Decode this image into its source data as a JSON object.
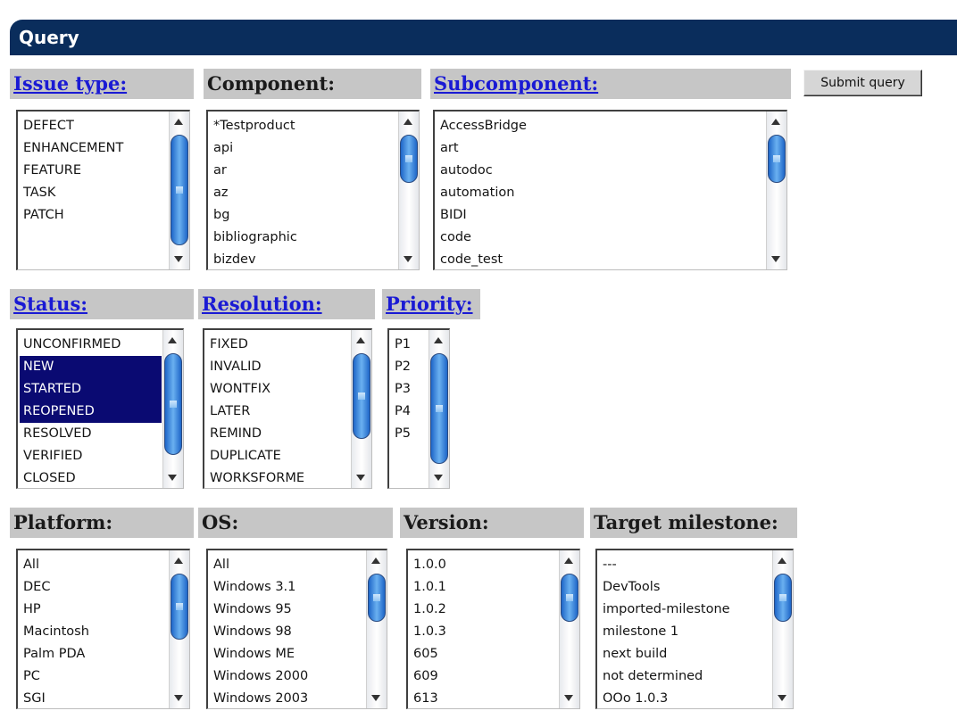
{
  "title": "Query",
  "submit_label": "Submit query",
  "fields": {
    "issue_type": {
      "label": "Issue type:",
      "options": [
        "DEFECT",
        "ENHANCEMENT",
        "FEATURE",
        "TASK",
        "PATCH"
      ]
    },
    "component": {
      "label": "Component:",
      "options": [
        "*Testproduct",
        "api",
        "ar",
        "az",
        "bg",
        "bibliographic",
        "bizdev"
      ]
    },
    "subcomponent": {
      "label": "Subcomponent:",
      "options": [
        "AccessBridge",
        "art",
        "autodoc",
        "automation",
        "BIDI",
        "code",
        "code_test"
      ]
    },
    "status": {
      "label": "Status:",
      "options": [
        "UNCONFIRMED",
        "NEW",
        "STARTED",
        "REOPENED",
        "RESOLVED",
        "VERIFIED",
        "CLOSED"
      ],
      "selected": [
        "NEW",
        "STARTED",
        "REOPENED"
      ]
    },
    "resolution": {
      "label": "Resolution:",
      "options": [
        "FIXED",
        "INVALID",
        "WONTFIX",
        "LATER",
        "REMIND",
        "DUPLICATE",
        "WORKSFORME"
      ]
    },
    "priority": {
      "label": "Priority:",
      "options": [
        "P1",
        "P2",
        "P3",
        "P4",
        "P5"
      ]
    },
    "platform": {
      "label": "Platform:",
      "options": [
        "All",
        "DEC",
        "HP",
        "Macintosh",
        "Palm PDA",
        "PC",
        "SGI"
      ]
    },
    "os": {
      "label": "OS:",
      "options": [
        "All",
        "Windows 3.1",
        "Windows 95",
        "Windows 98",
        "Windows ME",
        "Windows 2000",
        "Windows 2003"
      ]
    },
    "version": {
      "label": "Version:",
      "options": [
        "1.0.0",
        "1.0.1",
        "1.0.2",
        "1.0.3",
        "605",
        "609",
        "613"
      ]
    },
    "target_milestone": {
      "label": "Target milestone:",
      "options": [
        "---",
        "DevTools",
        "imported-milestone",
        "milestone 1",
        "next build",
        "not determined",
        "OOo 1.0.3"
      ]
    }
  },
  "colors": {
    "title_bar": "#0a2d5c",
    "header_bg": "#c6c6c6",
    "link": "#1a1ad4",
    "selected_bg": "#0a0a72"
  },
  "icons": {
    "scroll_up": "scroll-up-arrow-icon",
    "scroll_down": "scroll-down-arrow-icon",
    "scroll_thumb": "scroll-thumb"
  }
}
